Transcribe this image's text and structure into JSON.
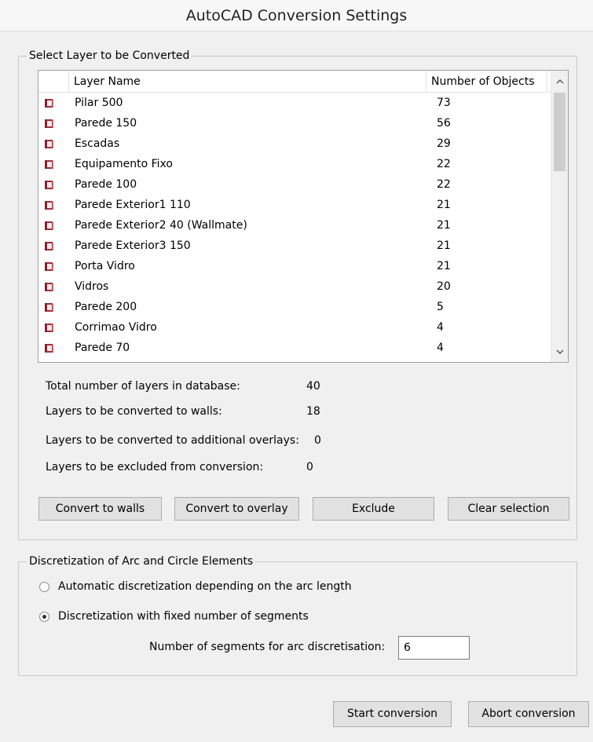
{
  "window": {
    "title": "AutoCAD Conversion Settings"
  },
  "layer_group": {
    "title": "Select Layer to be Converted",
    "columns": {
      "name": "Layer Name",
      "count": "Number of Objects"
    },
    "rows": [
      {
        "name": "Pilar 500",
        "count": "73"
      },
      {
        "name": "Parede 150",
        "count": "56"
      },
      {
        "name": "Escadas",
        "count": "29"
      },
      {
        "name": "Equipamento Fixo",
        "count": "22"
      },
      {
        "name": "Parede 100",
        "count": "22"
      },
      {
        "name": "Parede Exterior1 110",
        "count": "21"
      },
      {
        "name": "Parede Exterior2 40 (Wallmate)",
        "count": "21"
      },
      {
        "name": "Parede Exterior3 150",
        "count": "21"
      },
      {
        "name": "Porta Vidro",
        "count": "21"
      },
      {
        "name": "Vidros",
        "count": "20"
      },
      {
        "name": "Parede 200",
        "count": "5"
      },
      {
        "name": "Corrimao Vidro",
        "count": "4"
      },
      {
        "name": "Parede 70",
        "count": "4"
      }
    ],
    "row_icon": "layer-book-icon",
    "icon_color": "#a0303a",
    "stats": [
      {
        "label": "Total number of layers in database:",
        "value": "40"
      },
      {
        "label": "Layers to be converted to walls:",
        "value": "18"
      },
      {
        "label": "Layers to be converted to additional overlays:",
        "value": "0"
      },
      {
        "label": "Layers to be excluded from conversion:",
        "value": "0"
      }
    ],
    "buttons": {
      "convert_walls": "Convert to walls",
      "convert_overlay": "Convert to overlay",
      "exclude": "Exclude",
      "clear": "Clear selection"
    }
  },
  "discretization_group": {
    "title": "Discretization of Arc and Circle Elements",
    "option_auto": "Automatic discretization depending on the arc length",
    "option_fixed": "Discretization with fixed number of segments",
    "selected": "fixed",
    "segments_label": "Number of segments for arc discretisation:",
    "segments_value": "6"
  },
  "footer": {
    "start": "Start conversion",
    "abort": "Abort conversion"
  }
}
